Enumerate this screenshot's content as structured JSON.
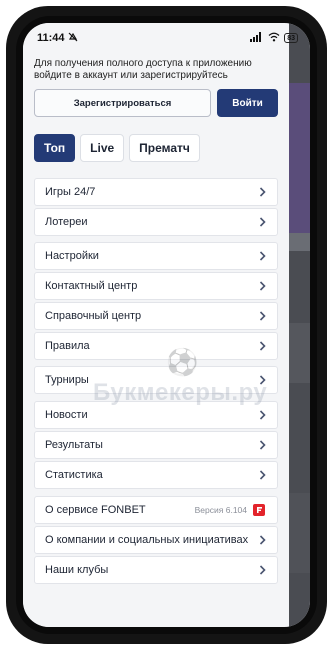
{
  "status_bar": {
    "time": "11:44",
    "battery": "83"
  },
  "auth": {
    "prompt": "Для получения полного доступа к приложению войдите в аккаунт или зарегистрируйтесь",
    "register_label": "Зарегистрироваться",
    "login_label": "Войти"
  },
  "tabs": [
    {
      "label": "Топ",
      "active": true
    },
    {
      "label": "Live",
      "active": false
    },
    {
      "label": "Прематч",
      "active": false
    }
  ],
  "menu_groups": [
    {
      "items": [
        {
          "label": "Игры 24/7"
        },
        {
          "label": "Лотереи"
        }
      ]
    },
    {
      "items": [
        {
          "label": "Настройки"
        },
        {
          "label": "Контактный центр"
        },
        {
          "label": "Справочный центр"
        },
        {
          "label": "Правила"
        }
      ]
    },
    {
      "items": [
        {
          "label": "Турниры"
        }
      ]
    },
    {
      "items": [
        {
          "label": "Новости"
        },
        {
          "label": "Результаты"
        },
        {
          "label": "Статистика"
        }
      ]
    },
    {
      "items": [
        {
          "label": "О сервисе FONBET",
          "version": "Версия 6.104"
        },
        {
          "label": "О компании и социальных инициативах"
        },
        {
          "label": "Наши клубы"
        }
      ]
    }
  ],
  "watermark": "Букмекеры.ру",
  "colors": {
    "accent": "#233a76",
    "brand_red": "#e3242b",
    "chevron": "#4a5470"
  }
}
